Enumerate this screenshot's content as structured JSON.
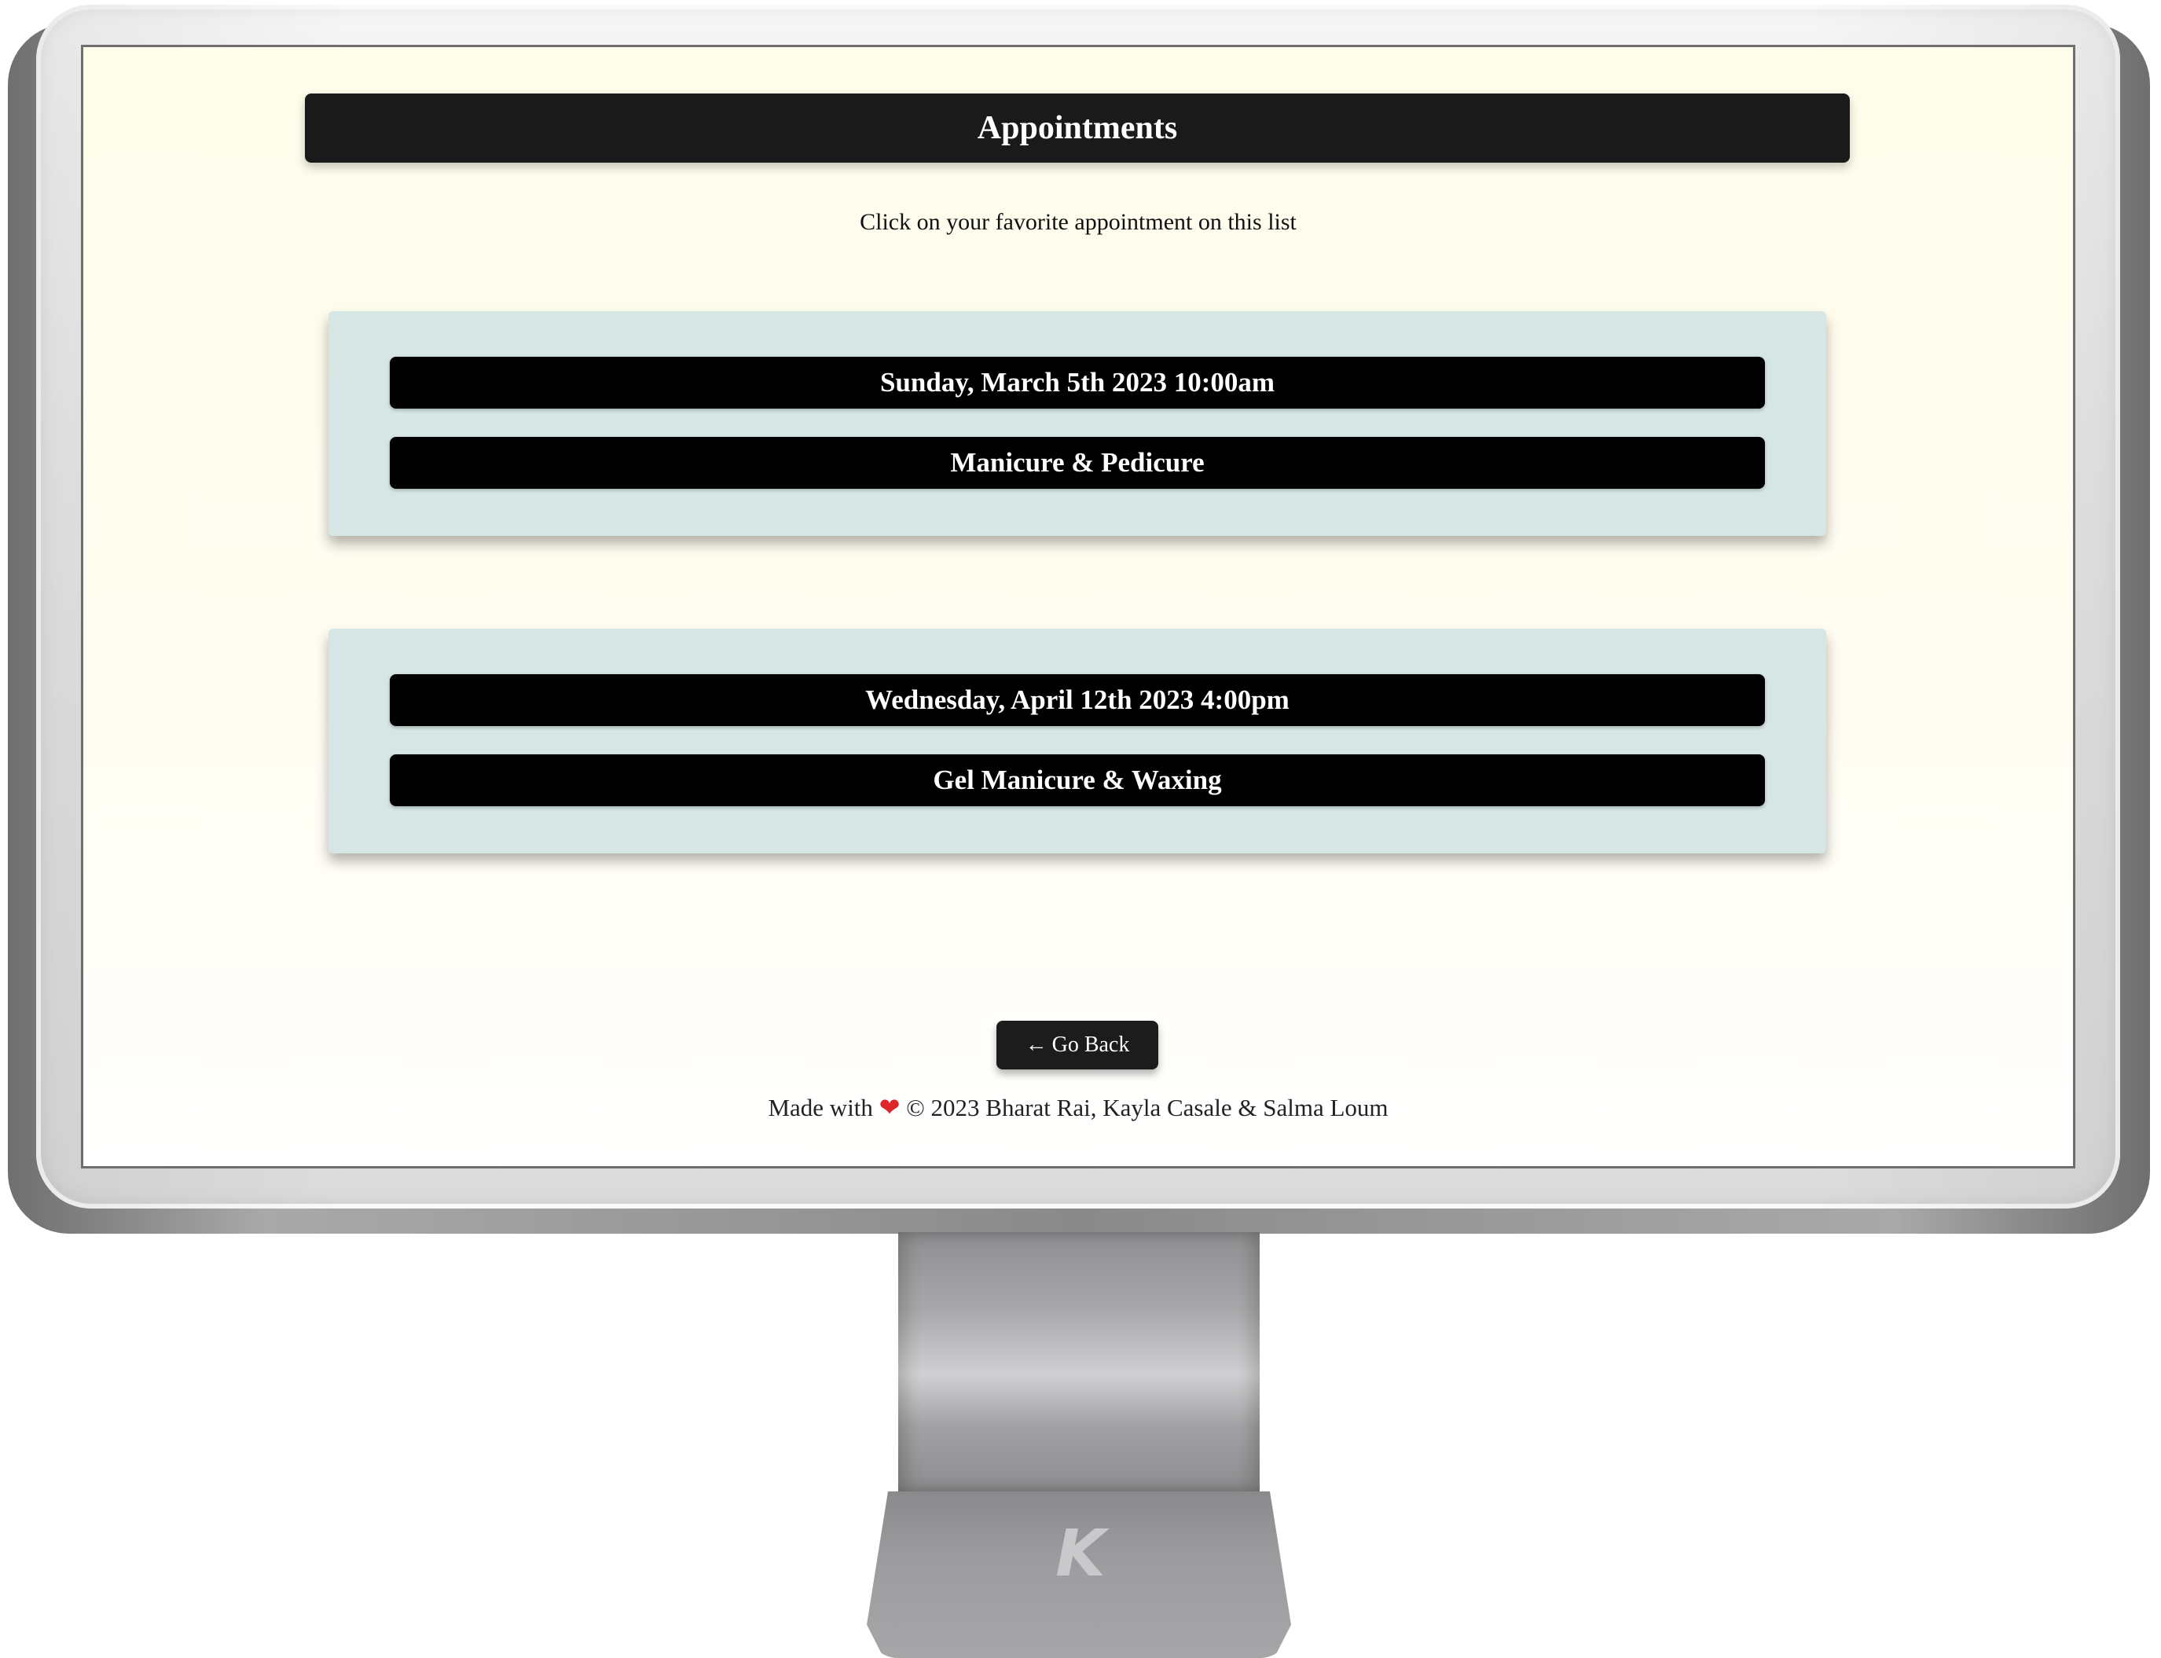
{
  "header": {
    "title": "Appointments"
  },
  "intro": {
    "text": "Click on your favorite appointment on this list"
  },
  "appointments": [
    {
      "datetime": "Sunday, March 5th 2023 10:00am",
      "service": "Manicure & Pedicure"
    },
    {
      "datetime": "Wednesday, April 12th 2023 4:00pm",
      "service": "Gel Manicure & Waxing"
    }
  ],
  "navigation": {
    "back_arrow": "←",
    "back_label": "Go Back"
  },
  "footer": {
    "made_with": "Made with",
    "heart_glyph": "❤",
    "credits": "© 2023 Bharat Rai, Kayla Casale & Salma Loum"
  },
  "stand": {
    "logo_letter": "K"
  },
  "colors": {
    "header_bg": "#1a1a1a",
    "card_bg": "#d6e6e4",
    "pill_bg": "#000000",
    "page_bg": "#fefcea",
    "heart": "#e0242b"
  },
  "icons": {
    "back": "left-arrow-icon",
    "heart": "heart-icon",
    "logo": "k-logo-icon"
  }
}
